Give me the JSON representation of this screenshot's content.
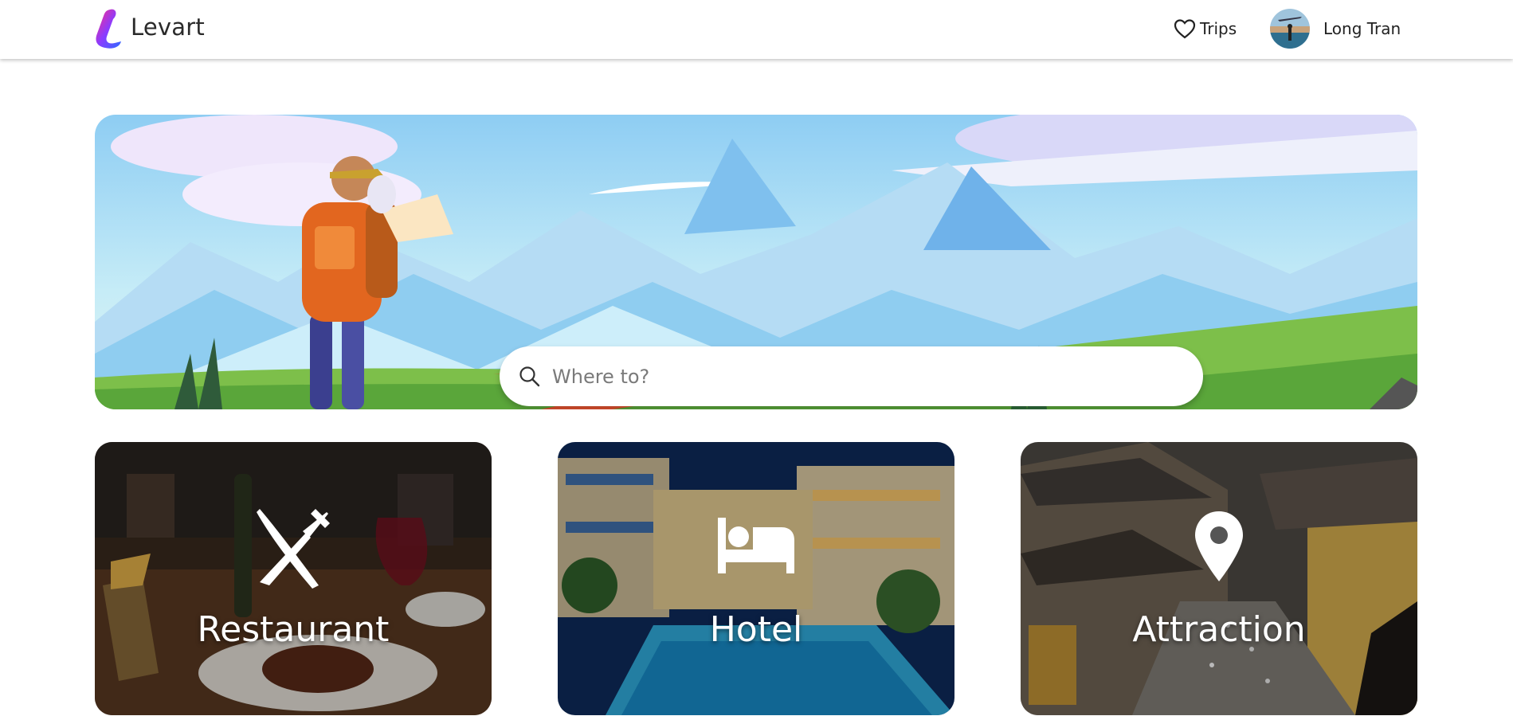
{
  "header": {
    "brand": "Levart",
    "trips_label": "Trips",
    "user_name": "Long Tran"
  },
  "search": {
    "placeholder": "Where to?"
  },
  "categories": [
    {
      "label": "Restaurant",
      "icon": "fork-knife-icon"
    },
    {
      "label": "Hotel",
      "icon": "bed-icon"
    },
    {
      "label": "Attraction",
      "icon": "map-pin-icon"
    }
  ],
  "colors": {
    "logo_gradient": [
      "#ff2d8a",
      "#7a3cff",
      "#2f6bff"
    ],
    "sky": "#a9dcf5",
    "grass": "#7cc04a"
  }
}
